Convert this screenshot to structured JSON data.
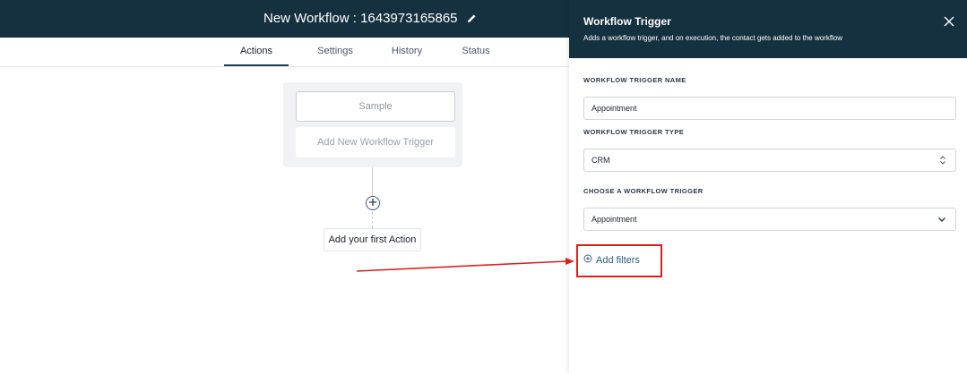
{
  "header": {
    "workflow_title": "New Workflow : 1643973165865"
  },
  "tabs": [
    {
      "label": "Actions",
      "active": true
    },
    {
      "label": "Settings",
      "active": false
    },
    {
      "label": "History",
      "active": false
    },
    {
      "label": "Status",
      "active": false
    }
  ],
  "canvas": {
    "trigger_card": "Sample",
    "add_trigger": "Add New Workflow Trigger",
    "first_action": "Add your first Action"
  },
  "panel": {
    "title": "Workflow Trigger",
    "subtitle": "Adds a workflow trigger, and on execution, the contact gets added to the workflow",
    "trigger_name_label": "WORKFLOW TRIGGER NAME",
    "trigger_name_value": "Appointment",
    "trigger_type_label": "WORKFLOW TRIGGER TYPE",
    "trigger_type_value": "CRM",
    "choose_trigger_label": "CHOOSE A WORKFLOW TRIGGER",
    "choose_trigger_value": "Appointment",
    "add_filters": "Add filters"
  },
  "colors": {
    "header_bg": "#15303f",
    "annotation_red": "#e01e1e",
    "link_blue": "#2b5d84"
  },
  "icons": [
    "pencil-icon",
    "plus-circle-icon",
    "close-icon",
    "updown-caret-icon",
    "chevron-down-icon",
    "plus-circle-small-icon"
  ]
}
